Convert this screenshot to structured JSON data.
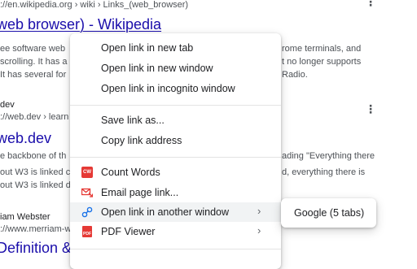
{
  "results": {
    "r1": {
      "breadcrumb": "://en.wikipedia.org › wiki › Links_(web_browser)",
      "title": "web browser) - Wikipedia",
      "snippet_lines": [
        "ee software web",
        "scrolling. It has a p",
        "It has several for"
      ],
      "snippet_right": [
        "rome terminals, and",
        "t no longer supports",
        "Radio."
      ]
    },
    "r2": {
      "site": "dev",
      "breadcrumb": "://web.dev › learn",
      "title": "web.dev",
      "snippet_lines": [
        "e backbone of th",
        "out W3 is linked c",
        "out W3 is linked dir"
      ],
      "snippet_right": [
        "ading \"Everything there",
        "d, everything there is",
        ""
      ]
    },
    "r3": {
      "site": "iam Webster",
      "breadcrumb": "://www.merriam-w",
      "title": "Definition &"
    },
    "kebab": "⋮"
  },
  "menu": {
    "items": [
      {
        "label": "Open link in new tab"
      },
      {
        "label": "Open link in new window"
      },
      {
        "label": "Open link in incognito window"
      },
      {
        "label": "Save link as..."
      },
      {
        "label": "Copy link address"
      },
      {
        "label": "Count Words",
        "icon": "count-words-icon",
        "icon_text": "CW"
      },
      {
        "label": "Email page link...",
        "icon": "email-icon"
      },
      {
        "label": "Open link in another window",
        "icon": "link-icon",
        "submenu": true
      },
      {
        "label": "PDF Viewer",
        "icon": "pdf-icon",
        "icon_text": "PDF",
        "submenu": true
      }
    ],
    "chevron": "›"
  },
  "submenu": {
    "items": [
      {
        "label": "Google (5 tabs)"
      }
    ]
  },
  "colors": {
    "link": "#1a0dab",
    "accent_red": "#e53935",
    "hover": "#f1f3f4"
  }
}
